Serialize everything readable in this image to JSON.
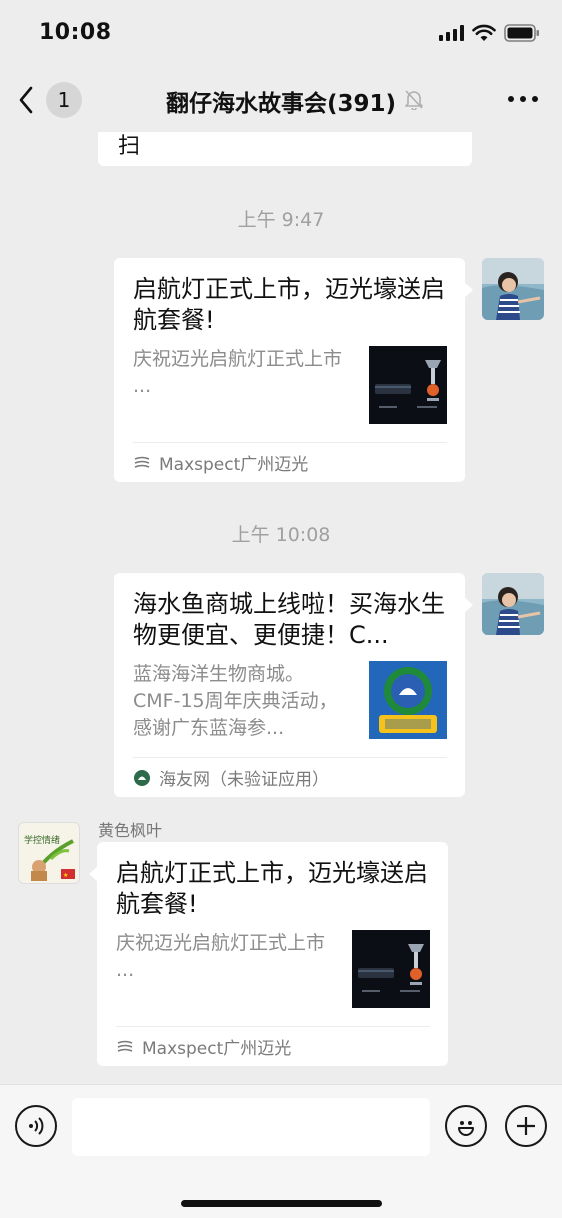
{
  "status_bar": {
    "time": "10:08"
  },
  "nav": {
    "back_badge": "1",
    "title": "翻仔海水故事会(391)"
  },
  "chat": {
    "partial_message": "扫",
    "timestamps": [
      "上午 9:47",
      "上午 10:08"
    ],
    "messages": [
      {
        "side": "right",
        "title": "启航灯正式上市，迈光壕送启航套餐!",
        "desc": "庆祝迈光启航灯正式上市\n...",
        "source": "Maxspect广州迈光"
      },
      {
        "side": "right",
        "title": "海水鱼商城上线啦！买海水生物更便宜、更便捷！C...",
        "desc": "蓝海海洋生物商城。CMF-15周年庆典活动，感谢广东蓝海参...",
        "source": "海友网（未验证应用）"
      },
      {
        "side": "left",
        "sender": "黄色枫叶",
        "title": "启航灯正式上市，迈光壕送启航套餐!",
        "desc": "庆祝迈光启航灯正式上市\n...",
        "source": "Maxspect广州迈光",
        "avatar_text": "学 控 情 绪"
      }
    ]
  },
  "colors": {
    "background": "#ededed",
    "bubble": "#ffffff",
    "timestamp": "#a0a0a0"
  }
}
